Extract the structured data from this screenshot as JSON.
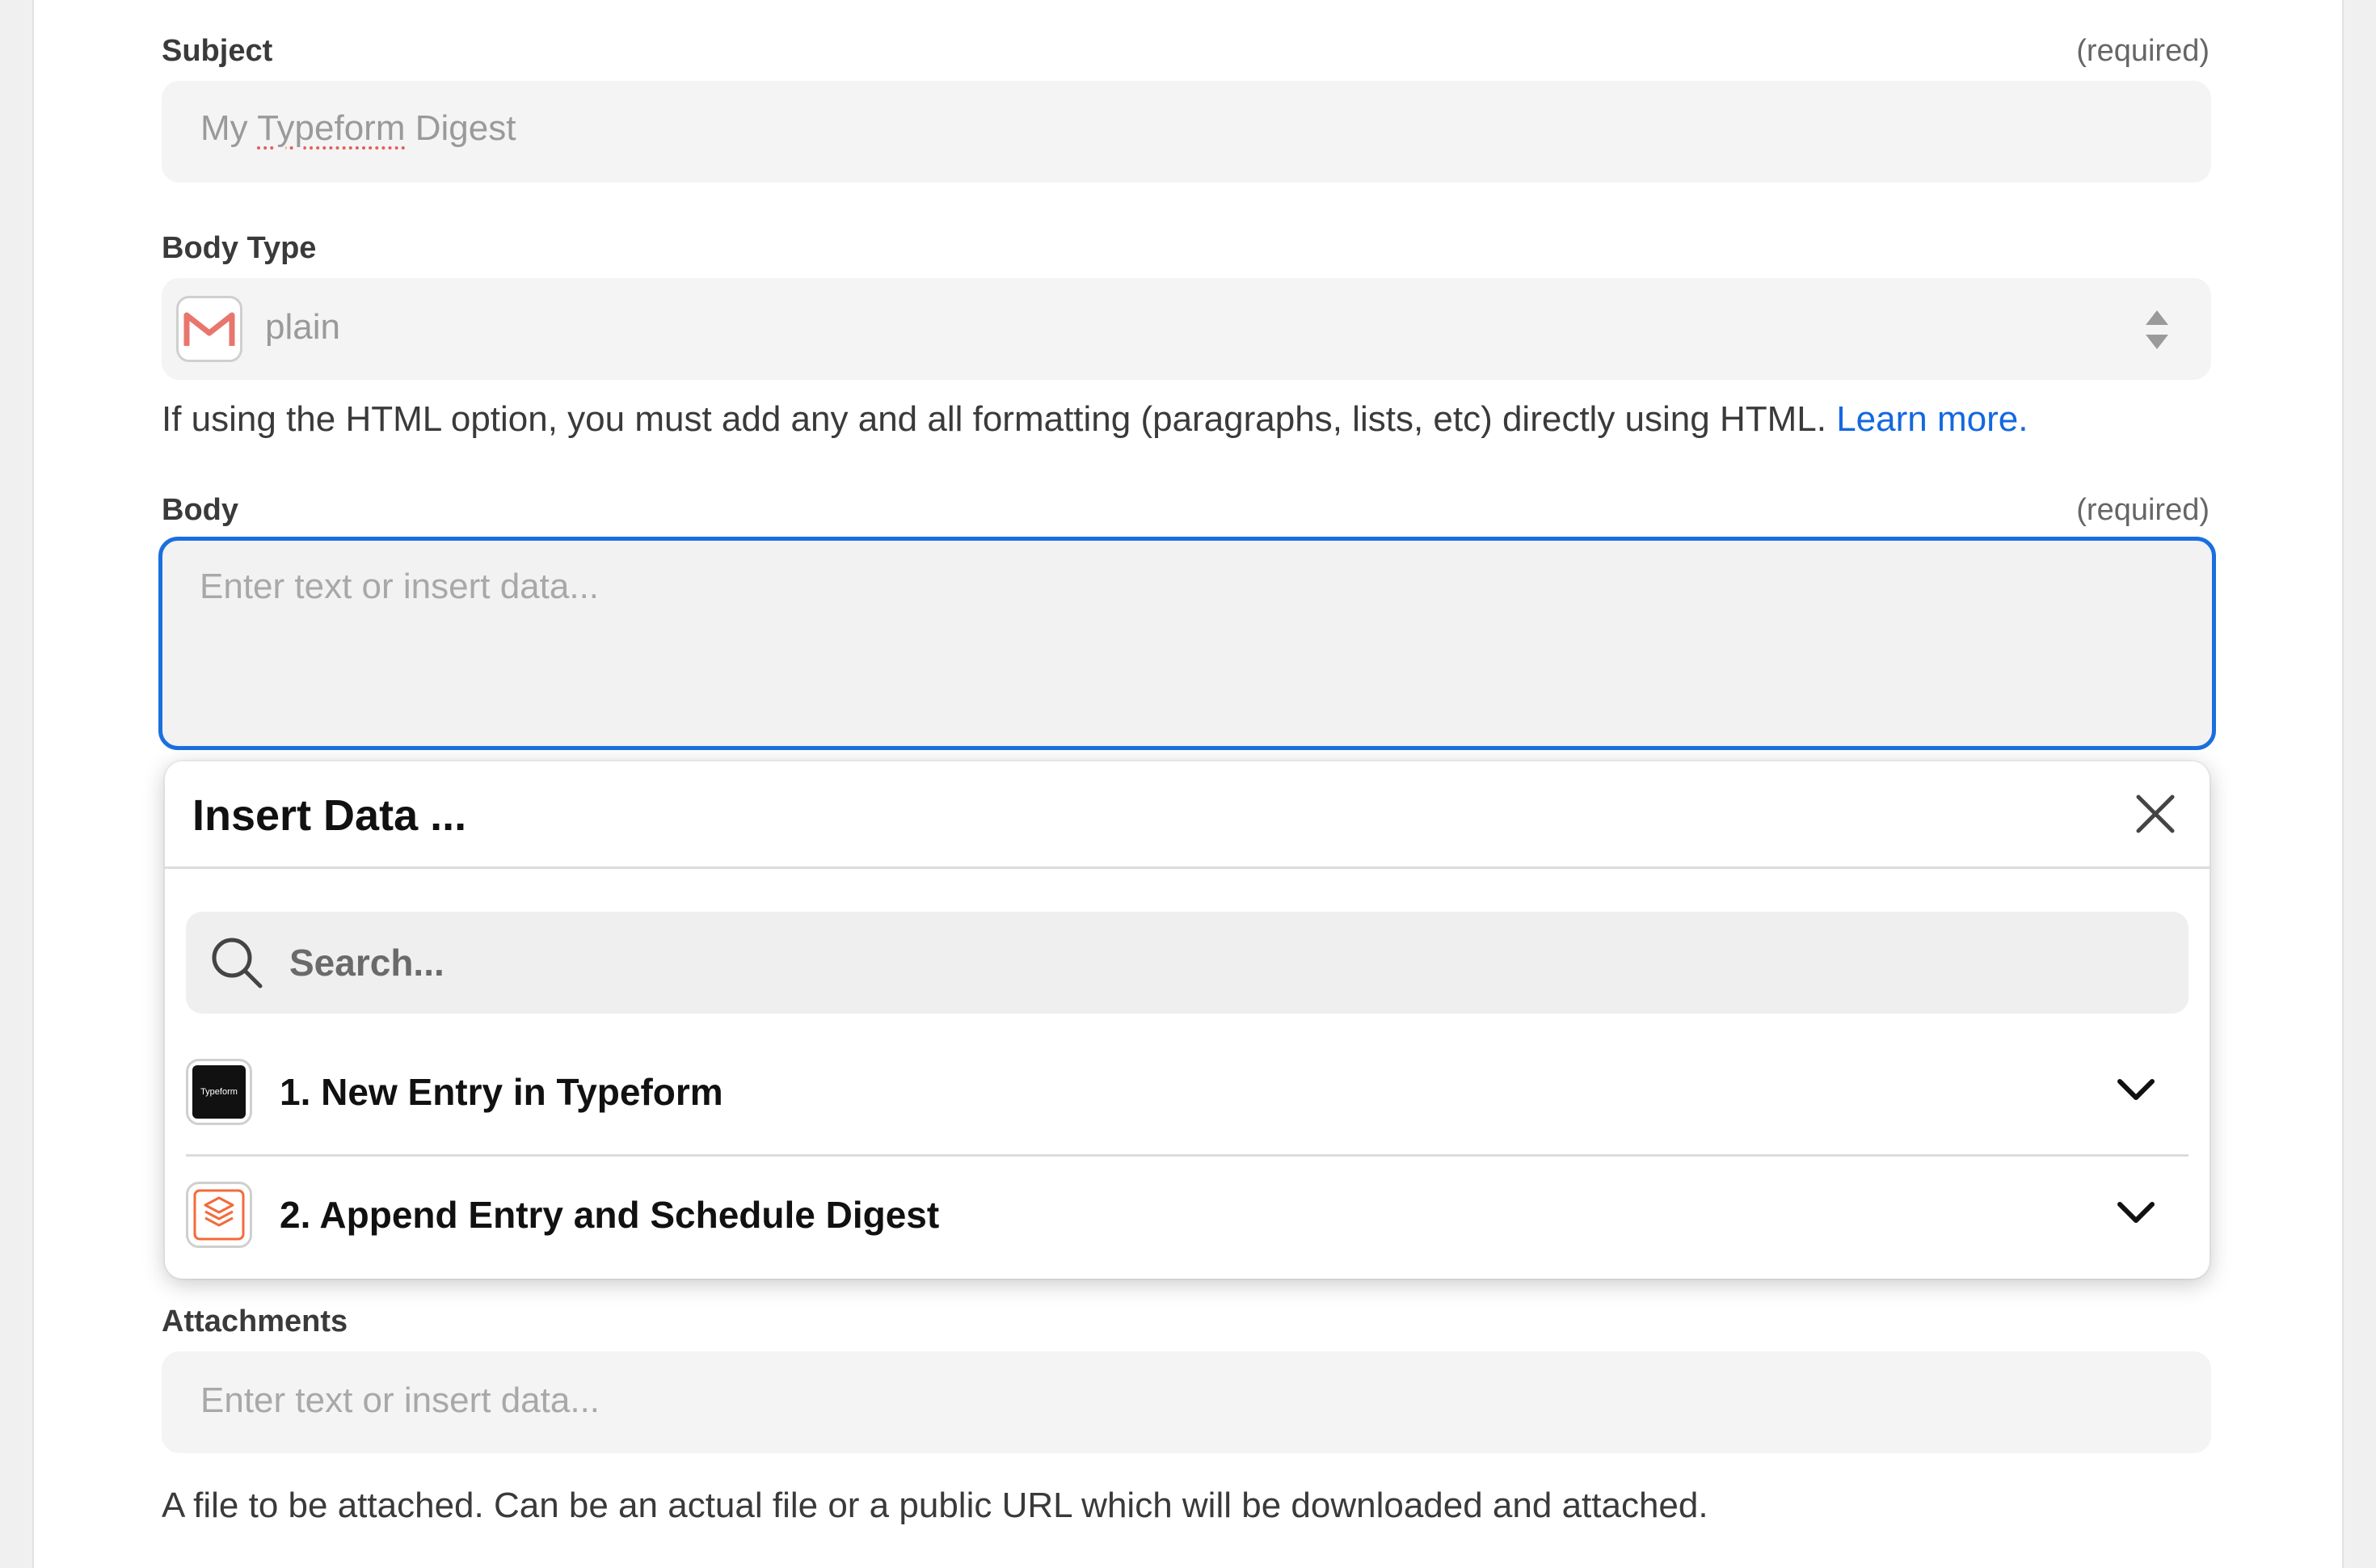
{
  "subject": {
    "label": "Subject",
    "required": "(required)",
    "value_prefix": "My ",
    "value_word": "Typeform",
    "value_suffix": " Digest"
  },
  "body_type": {
    "label": "Body Type",
    "value": "plain",
    "app_icon": "gmail-icon",
    "help_text": "If using the HTML option, you must add any and all formatting (paragraphs, lists, etc) directly using HTML. ",
    "help_link": "Learn more."
  },
  "body": {
    "label": "Body",
    "required": "(required)",
    "placeholder": "Enter text or insert data..."
  },
  "insert_data": {
    "title": "Insert Data ...",
    "search_placeholder": "Search...",
    "items": [
      {
        "label": "1. New Entry in Typeform",
        "icon": "typeform-icon",
        "icon_text": "Typeform"
      },
      {
        "label": "2. Append Entry and Schedule Digest",
        "icon": "digest-icon"
      }
    ]
  },
  "attachments": {
    "label": "Attachments",
    "placeholder": "Enter text or insert data...",
    "help_text": "A file to be attached. Can be an actual file or a public URL which will be downloaded and attached."
  },
  "colors": {
    "focus_border": "#1a6fe0",
    "link": "#1368e0",
    "gmail_red": "#e0605a",
    "digest_orange": "#f26b3a"
  }
}
